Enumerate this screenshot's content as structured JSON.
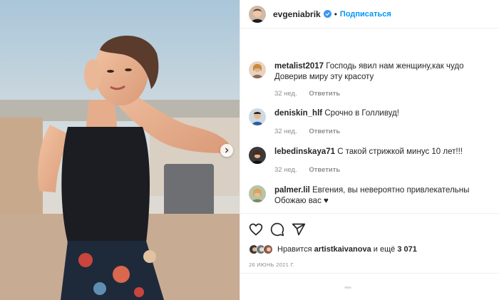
{
  "header": {
    "username": "evgeniabrik",
    "separator": "•",
    "follow_label": "Подписаться",
    "verified_icon": "verified-badge-icon"
  },
  "comments": [
    {
      "user": "metalist2017",
      "text": "Господь явил нам женщину,как чудо Доверив миру эту красоту",
      "age": "32 нед.",
      "reply": "Ответить"
    },
    {
      "user": "deniskin_hlf",
      "text": "Срочно в Голливуд!",
      "age": "32 нед.",
      "reply": "Ответить"
    },
    {
      "user": "lebedinskaya71",
      "text": "С такой стрижкой минус 10 лет!!!",
      "age": "32 нед.",
      "reply": "Ответить"
    },
    {
      "user": "palmer.lil",
      "text": "Евгения, вы невероятно привлекательны Обожаю вас ♥",
      "age": "",
      "reply": ""
    }
  ],
  "actions": {
    "like_icon": "heart-icon",
    "comment_icon": "comment-icon",
    "share_icon": "share-icon"
  },
  "likes": {
    "prefix": "Нравится",
    "user": "artistkaivanova",
    "middle": "и ещё",
    "count": "3 071"
  },
  "date": "26 ИЮНЬ 2021 Г.",
  "colors": {
    "accent": "#0095f6",
    "muted": "#8e8e8e",
    "text": "#262626"
  }
}
